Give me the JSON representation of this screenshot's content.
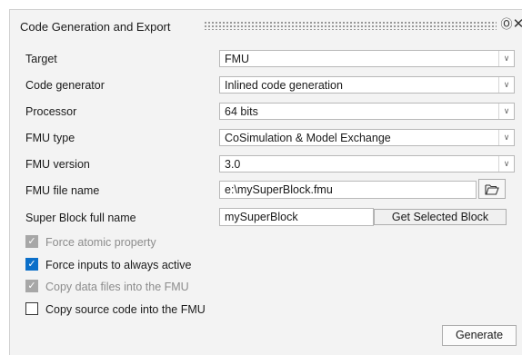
{
  "window": {
    "title": "Code Generation and Export",
    "help_icon": "?",
    "close_icon": "✕"
  },
  "fields": {
    "target": {
      "label": "Target",
      "value": "FMU"
    },
    "code_generator": {
      "label": "Code generator",
      "value": "Inlined code generation"
    },
    "processor": {
      "label": "Processor",
      "value": "64 bits"
    },
    "fmu_type": {
      "label": "FMU type",
      "value": "CoSimulation & Model Exchange"
    },
    "fmu_version": {
      "label": "FMU version",
      "value": "3.0"
    },
    "fmu_file_name": {
      "label": "FMU file name",
      "value": "e:\\mySuperBlock.fmu"
    },
    "super_block_full_name": {
      "label": "Super Block full name",
      "value": "mySuperBlock",
      "button": "Get Selected Block"
    }
  },
  "dropdown_arrow": "∨",
  "checkboxes": [
    {
      "label": "Force atomic property",
      "checked": true,
      "enabled": false
    },
    {
      "label": "Force inputs to always active",
      "checked": true,
      "enabled": true
    },
    {
      "label": "Copy data files into the FMU",
      "checked": true,
      "enabled": false
    },
    {
      "label": "Copy source code into the FMU",
      "checked": false,
      "enabled": true
    }
  ],
  "check_glyph": "✓",
  "actions": {
    "generate": "Generate"
  },
  "icons": [
    "help-icon",
    "close-icon",
    "chevron-down-icon",
    "folder-icon"
  ],
  "colors": {
    "checkbox_checked": "#0b6fc9",
    "checkbox_disabled": "#a7a7a7",
    "panel_bg": "#f3f3f3"
  }
}
